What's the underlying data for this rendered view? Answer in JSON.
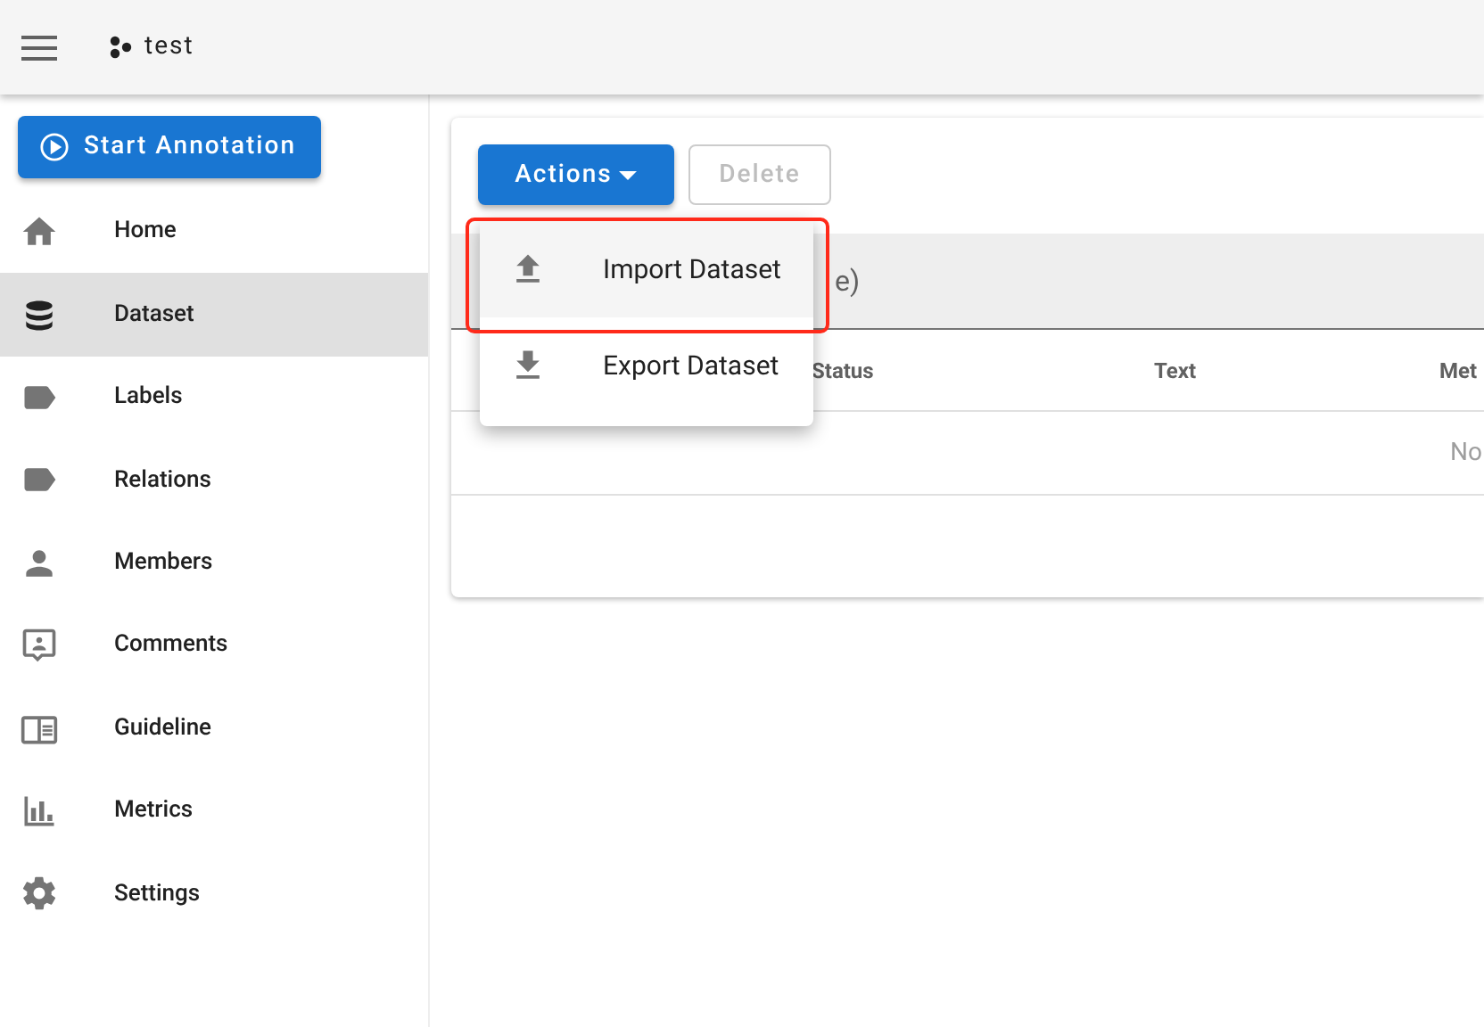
{
  "app_bar": {
    "title": "test"
  },
  "start_button": {
    "label": "Start Annotation"
  },
  "sidebar": {
    "items": [
      {
        "label": "Home",
        "selected": false
      },
      {
        "label": "Dataset",
        "selected": true
      },
      {
        "label": "Labels",
        "selected": false
      },
      {
        "label": "Relations",
        "selected": false
      },
      {
        "label": "Members",
        "selected": false
      },
      {
        "label": "Comments",
        "selected": false
      },
      {
        "label": "Guideline",
        "selected": false
      },
      {
        "label": "Metrics",
        "selected": false
      },
      {
        "label": "Settings",
        "selected": false
      }
    ]
  },
  "toolbar": {
    "actions": "Actions",
    "delete": {
      "label": "Delete",
      "disabled": true
    }
  },
  "search_bar": {
    "text": "e)"
  },
  "table": {
    "columns": [
      "Status",
      "Text",
      "Met"
    ],
    "empty_text": "No"
  },
  "menu": {
    "items": [
      {
        "label": "Import Dataset",
        "highlighted": true
      },
      {
        "label": "Export Dataset",
        "highlighted": false
      }
    ]
  }
}
